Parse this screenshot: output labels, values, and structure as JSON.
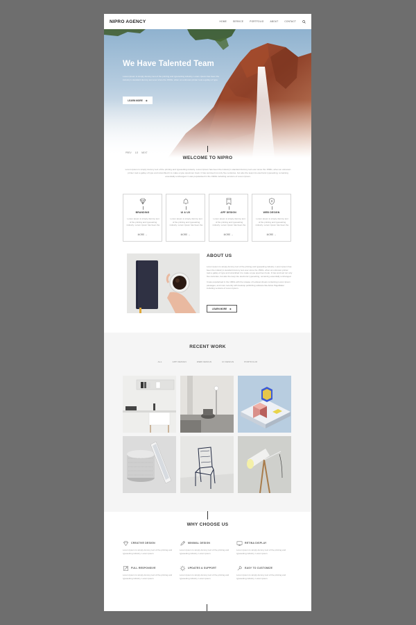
{
  "header": {
    "brand": "NIPRO AGENCY",
    "nav": [
      "HOME",
      "SERVICE",
      "PORTFOLIO",
      "ABOUT",
      "CONTACT"
    ]
  },
  "hero": {
    "title": "We Have Talented Team",
    "text": "Lorem Ipsum is simply dummy text of the printing and typesetting industry. Lorem Ipsum has been the industry's standard dummy text ever since the 1500s, when an unknown printer took a galley of type.",
    "button": "LEARN MORE",
    "pager": [
      "PREV",
      "1/3",
      "NEXT"
    ]
  },
  "welcome": {
    "title": "WELCOME TO NIPRO",
    "text": "Lorem Ipsum is simply dummy text of the printing and typesetting industry. Lorem Ipsum has been the industry's standard dummy text ever since the 1500s, when an unknown printer took a galley of type and scrambled it to make a type specimen book. It has survived not only five centuries, but also the leap into electronic typesetting, remaining essentially unchanged. It was popularised in the 1960s including versions of Lorem Ipsum."
  },
  "services": [
    {
      "icon": "diamond-icon",
      "title": "BRANDING",
      "text": "Lorem Ipsum is simply dummy text of the printing and typesetting industry. Lorem Ipsum has been the",
      "more": "MORE"
    },
    {
      "icon": "bell-icon",
      "title": "UI & UX",
      "text": "Lorem Ipsum is simply dummy text of the printing and typesetting industry. Lorem Ipsum has been the",
      "more": "MORE"
    },
    {
      "icon": "bookmark-icon",
      "title": "APP DESIGN",
      "text": "Lorem Ipsum is simply dummy text of the printing and typesetting industry. Lorem Ipsum has been the",
      "more": "MORE"
    },
    {
      "icon": "shield-icon",
      "title": "WEB DESIGN",
      "text": "Lorem Ipsum is simply dummy text of the printing and typesetting industry. Lorem Ipsum has been the",
      "more": "MORE"
    }
  ],
  "about": {
    "title": "ABOUT US",
    "text1": "Lorem Ipsum is simply dummy text of the printing and typesetting industry. Lorem Ipsum has been the industry's standard dummy text ever since the 1500s, when an unknown printer took a galley of type and scrambled it to make a type specimen book. It has survived not only five centuries, but also the leap into electronic typesetting, remaining essentially unchanged.",
    "text2": "It was popularised in the 1960s with the release of Letraset sheets containing Lorem Ipsum passages, and more recently with desktop publishing software like Aldus PageMaker including versions of Lorem Ipsum.",
    "button": "LEARN MORE"
  },
  "recent_work": {
    "title": "RECENT WORK",
    "filters": [
      "ALL",
      "APP DESIGN",
      "WEB DESIGN",
      "UI DESIGN",
      "PORTFOLIO"
    ]
  },
  "why": {
    "title": "WHY CHOOSE US",
    "features": [
      {
        "icon": "diamond-icon",
        "title": "CREATIVE DESIGN",
        "text": "Lorem Ipsum is simply dummy text of the printing and typesetting industry. Lorem ipsum"
      },
      {
        "icon": "pencil-icon",
        "title": "MINIMAL DESIGN",
        "text": "Lorem Ipsum is simply dummy text of the printing and typesetting industry. Lorem ipsum"
      },
      {
        "icon": "monitor-icon",
        "title": "RETINA DISPLAY",
        "text": "Lorem Ipsum is simply dummy text of the printing and typesetting industry. Lorem ipsum"
      },
      {
        "icon": "expand-icon",
        "title": "FULL RESPONSIVE",
        "text": "Lorem Ipsum is simply dummy text of the printing and typesetting industry. Lorem ipsum"
      },
      {
        "icon": "gear-icon",
        "title": "UPDATES & SUPPORT",
        "text": "Lorem Ipsum is simply dummy text of the printing and typesetting industry. Lorem ipsum"
      },
      {
        "icon": "wrench-icon",
        "title": "EASY TO CUSTOMIZE",
        "text": "Lorem Ipsum is simply dummy text of the printing and typesetting industry. Lorem ipsum"
      }
    ]
  },
  "colors": {
    "backdrop": "#6e6e6e",
    "page": "#ffffff",
    "gray_section": "#f5f5f5",
    "text_dark": "#333333",
    "text_muted": "#999999"
  }
}
